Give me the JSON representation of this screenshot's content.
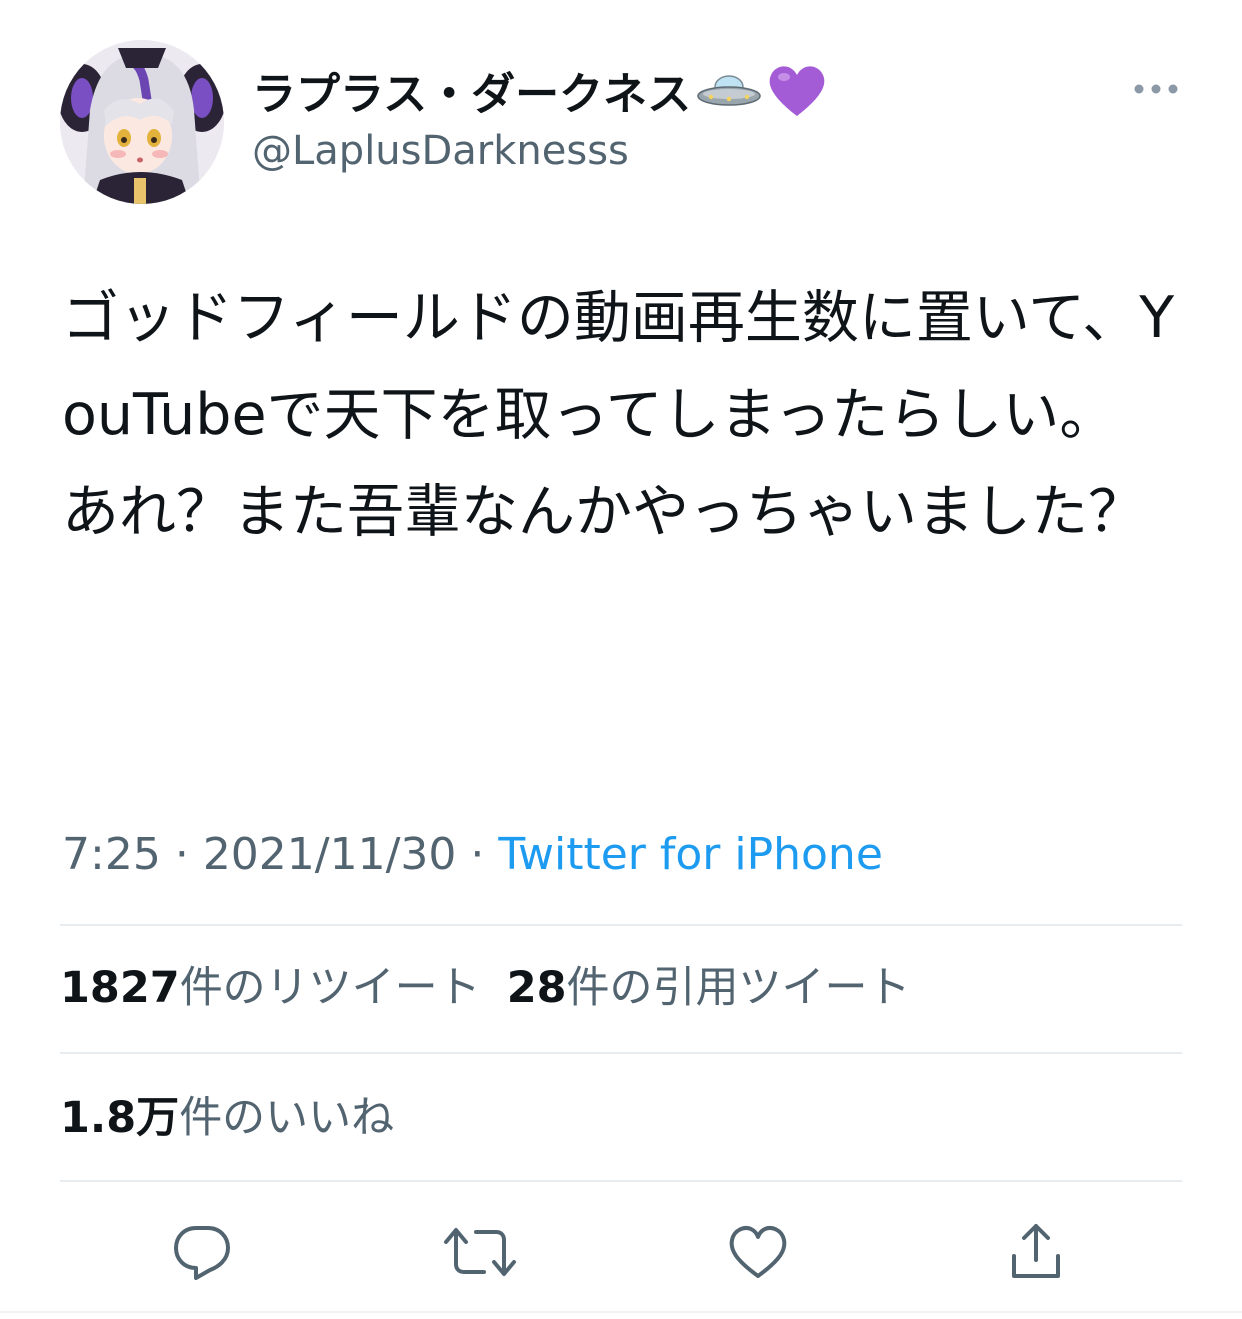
{
  "author": {
    "display_name": "ラプラス・ダークネス",
    "handle": "@LaplusDarknesss",
    "emoji_icons": [
      "flying-saucer-icon",
      "purple-heart-icon"
    ]
  },
  "tweet": {
    "text": "ゴッドフィールドの動画再生数に置いて、YouTubeで天下を取ってしまったらしい。\nあれ？また吾輩なんかやっちゃいました？",
    "time": "7:25",
    "separator": "·",
    "date": "2021/11/30",
    "source": "Twitter for iPhone"
  },
  "stats": {
    "retweets_count": "1827",
    "retweets_label": "件のリツイート",
    "quotes_count": "28",
    "quotes_label": "件の引用ツイート",
    "likes_count": "1.8万",
    "likes_label": "件のいいね"
  },
  "actions": [
    "reply-icon",
    "retweet-icon",
    "like-icon",
    "share-icon"
  ],
  "colors": {
    "text": "#0f1419",
    "secondary": "#536471",
    "link": "#1d9bf0",
    "divider": "#e6ecf0",
    "heart_emoji": "#a45bd6"
  }
}
